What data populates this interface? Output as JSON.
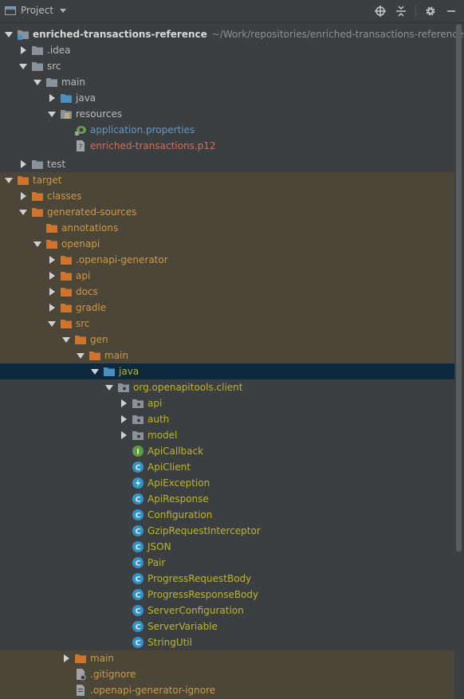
{
  "toolbar": {
    "title": "Project"
  },
  "tree": {
    "rows": [
      {
        "id": "root",
        "label": "enriched-transactions-reference",
        "path": "~/Work/repositories/enriched-transactions-reference"
      },
      {
        "id": "idea",
        "label": ".idea"
      },
      {
        "id": "src",
        "label": "src"
      },
      {
        "id": "main",
        "label": "main"
      },
      {
        "id": "java",
        "label": "java"
      },
      {
        "id": "resources",
        "label": "resources"
      },
      {
        "id": "app_props",
        "label": "application.properties"
      },
      {
        "id": "p12",
        "label": "enriched-transactions.p12"
      },
      {
        "id": "test",
        "label": "test"
      },
      {
        "id": "target",
        "label": "target"
      },
      {
        "id": "classes",
        "label": "classes"
      },
      {
        "id": "gen_sources",
        "label": "generated-sources"
      },
      {
        "id": "annotations",
        "label": "annotations"
      },
      {
        "id": "openapi",
        "label": "openapi"
      },
      {
        "id": "openapi_gen",
        "label": ".openapi-generator"
      },
      {
        "id": "api_dir",
        "label": "api"
      },
      {
        "id": "docs",
        "label": "docs"
      },
      {
        "id": "gradle",
        "label": "gradle"
      },
      {
        "id": "src2",
        "label": "src"
      },
      {
        "id": "gen",
        "label": "gen"
      },
      {
        "id": "main2",
        "label": "main"
      },
      {
        "id": "java2",
        "label": "java"
      },
      {
        "id": "pkg",
        "label": "org.openapitools.client"
      },
      {
        "id": "pkg_api",
        "label": "api"
      },
      {
        "id": "pkg_auth",
        "label": "auth"
      },
      {
        "id": "pkg_model",
        "label": "model"
      },
      {
        "id": "ApiCallback",
        "label": "ApiCallback",
        "badge": "I"
      },
      {
        "id": "ApiClient",
        "label": "ApiClient",
        "badge": "C"
      },
      {
        "id": "ApiException",
        "label": "ApiException",
        "badge": "⚡"
      },
      {
        "id": "ApiResponse",
        "label": "ApiResponse",
        "badge": "C"
      },
      {
        "id": "Configuration",
        "label": "Configuration",
        "badge": "C"
      },
      {
        "id": "Gzip",
        "label": "GzipRequestInterceptor",
        "badge": "C"
      },
      {
        "id": "JSON",
        "label": "JSON",
        "badge": "C"
      },
      {
        "id": "Pair",
        "label": "Pair",
        "badge": "C"
      },
      {
        "id": "ProgressReq",
        "label": "ProgressRequestBody",
        "badge": "C"
      },
      {
        "id": "ProgressResp",
        "label": "ProgressResponseBody",
        "badge": "C"
      },
      {
        "id": "ServerConfig",
        "label": "ServerConfiguration",
        "badge": "C"
      },
      {
        "id": "ServerVar",
        "label": "ServerVariable",
        "badge": "C"
      },
      {
        "id": "StringUtil",
        "label": "StringUtil",
        "badge": "C"
      },
      {
        "id": "main3",
        "label": "main"
      },
      {
        "id": "gitignore",
        "label": ".gitignore"
      },
      {
        "id": "oa_ignore",
        "label": ".openapi-generator-ignore"
      }
    ]
  },
  "colors": {
    "background": "#3c3f41",
    "excluded_row": "#4b4637",
    "selected_row": "#0d293e",
    "excluded_text": "#cc9a48",
    "class_text": "#bbb529",
    "link_blue": "#6897bb",
    "error_red": "#d46c58",
    "folder_grey": "#8a9299",
    "folder_orange": "#d0732d",
    "source_blue": "#4a8fc0"
  }
}
